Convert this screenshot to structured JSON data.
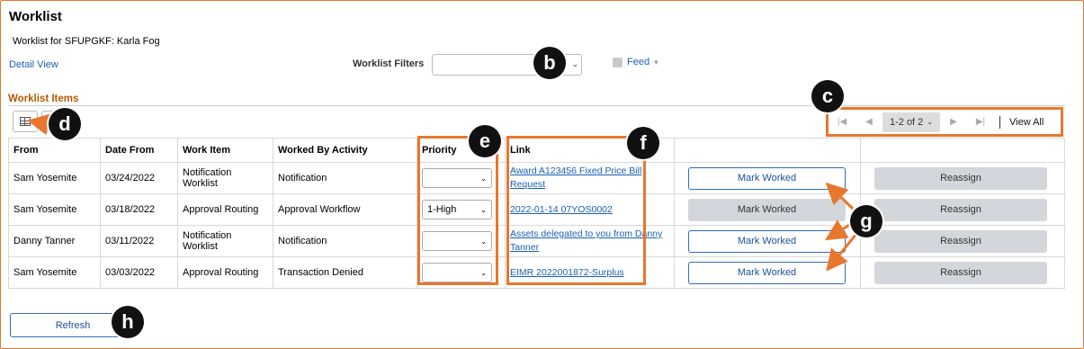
{
  "page": {
    "title": "Worklist",
    "subtitle": "Worklist for SFUPGKF: Karla Fog",
    "detail_link": "Detail View",
    "filters_label": "Worklist Filters",
    "filters_value": "",
    "feed_label": "Feed",
    "section_title": "Worklist Items"
  },
  "pager": {
    "range": "1-2 of 2",
    "view_all": "View All"
  },
  "table": {
    "columns": [
      "From",
      "Date From",
      "Work Item",
      "Worked By Activity",
      "Priority",
      "Link",
      "",
      ""
    ],
    "rows": [
      {
        "from": "Sam Yosemite",
        "date": "03/24/2022",
        "work_item": "Notification Worklist",
        "activity": "Notification",
        "priority": "",
        "link": "Award A123456 Fixed Price Bill Request",
        "mark_label": "Mark Worked",
        "mark_enabled": true,
        "reassign_label": "Reassign"
      },
      {
        "from": "Sam Yosemite",
        "date": "03/18/2022",
        "work_item": "Approval Routing",
        "activity": "Approval Workflow",
        "priority": "1-High",
        "link": "2022-01-14 07YOS0002",
        "mark_label": "Mark Worked",
        "mark_enabled": false,
        "reassign_label": "Reassign"
      },
      {
        "from": "Danny Tanner",
        "date": "03/11/2022",
        "work_item": "Notification Worklist",
        "activity": "Notification",
        "priority": "",
        "link": "Assets delegated to you from Danny Tanner",
        "mark_label": "Mark Worked",
        "mark_enabled": true,
        "reassign_label": "Reassign"
      },
      {
        "from": "Sam Yosemite",
        "date": "03/03/2022",
        "work_item": "Approval Routing",
        "activity": "Transaction Denied",
        "priority": "",
        "link": "EIMR 2022001872-Surplus",
        "mark_label": "Mark Worked",
        "mark_enabled": true,
        "reassign_label": "Reassign"
      }
    ]
  },
  "refresh_label": "Refresh",
  "callouts": {
    "b": "b",
    "c": "c",
    "d": "d",
    "e": "e",
    "f": "f",
    "g": "g",
    "h": "h"
  },
  "colors": {
    "accent": "#e8772e",
    "link": "#1a5fb4",
    "section": "#b35b00"
  }
}
